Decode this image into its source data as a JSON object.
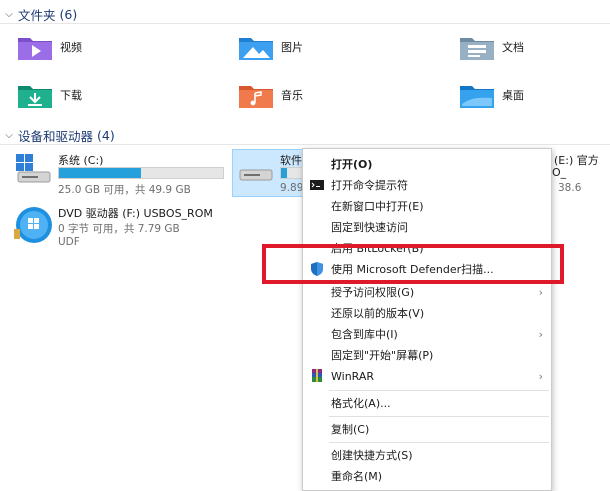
{
  "sections": {
    "folders": {
      "label": "文件夹",
      "count": "(6)"
    },
    "drives": {
      "label": "设备和驱动器",
      "count": "(4)"
    }
  },
  "folders": [
    {
      "name": "视频"
    },
    {
      "name": "图片"
    },
    {
      "name": "文档"
    },
    {
      "name": "下载"
    },
    {
      "name": "音乐"
    },
    {
      "name": "桌面"
    }
  ],
  "drives": {
    "c": {
      "name": "系统 (C:)",
      "size": "25.0 GB 可用，共 49.9 GB",
      "used_fraction": 0.5
    },
    "d": {
      "name": "软件",
      "size": "9.89",
      "used_fraction": 0.1
    },
    "e": {
      "name": "(E:) 官方",
      "line2": "O_",
      "size": "38.6"
    },
    "f": {
      "name": "DVD 驱动器 (F:) USBOS_ROM",
      "size": "0 字节 可用，共 7.79 GB",
      "fs": "UDF"
    }
  },
  "context_menu": {
    "items": [
      {
        "label": "打开(O)",
        "bold": true
      },
      {
        "label": "打开命令提示符"
      },
      {
        "label": "在新窗口中打开(E)"
      },
      {
        "label": "固定到快速访问"
      },
      {
        "label": "启用 BitLocker(B)"
      },
      {
        "label": "使用 Microsoft Defender扫描..."
      },
      {
        "label": "授予访问权限(G)"
      },
      {
        "label": "还原以前的版本(V)"
      },
      {
        "label": "包含到库中(I)"
      },
      {
        "label": "固定到\"开始\"屏幕(P)"
      },
      {
        "label": "WinRAR"
      },
      {
        "label": "格式化(A)..."
      },
      {
        "label": "复制(C)"
      },
      {
        "label": "创建快捷方式(S)"
      },
      {
        "label": "重命名(M)"
      }
    ],
    "submenu_arrow": "›"
  },
  "colors": {
    "accent": "#26a0da",
    "highlight": "#e0192a",
    "selection": "#cce8ff"
  }
}
